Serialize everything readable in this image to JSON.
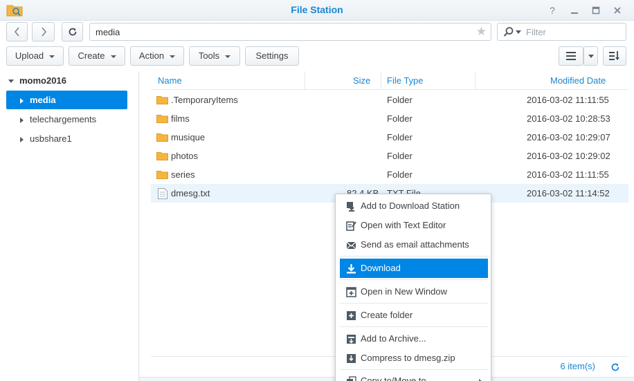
{
  "window": {
    "title": "File Station"
  },
  "toolbar": {
    "path": "media",
    "filter_placeholder": "Filter",
    "upload": "Upload",
    "create": "Create",
    "action": "Action",
    "tools": "Tools",
    "settings": "Settings"
  },
  "sidebar": {
    "root": "momo2016",
    "items": [
      {
        "label": "media",
        "selected": true
      },
      {
        "label": "telechargements",
        "selected": false
      },
      {
        "label": "usbshare1",
        "selected": false
      }
    ]
  },
  "table": {
    "columns": {
      "name": "Name",
      "size": "Size",
      "type": "File Type",
      "modified": "Modified Date"
    },
    "rows": [
      {
        "name": ".TemporaryItems",
        "size": "",
        "type": "Folder",
        "modified": "2016-03-02 11:11:55",
        "kind": "folder"
      },
      {
        "name": "films",
        "size": "",
        "type": "Folder",
        "modified": "2016-03-02 10:28:53",
        "kind": "folder"
      },
      {
        "name": "musique",
        "size": "",
        "type": "Folder",
        "modified": "2016-03-02 10:29:07",
        "kind": "folder"
      },
      {
        "name": "photos",
        "size": "",
        "type": "Folder",
        "modified": "2016-03-02 10:29:02",
        "kind": "folder"
      },
      {
        "name": "series",
        "size": "",
        "type": "Folder",
        "modified": "2016-03-02 11:11:55",
        "kind": "folder"
      },
      {
        "name": "dmesg.txt",
        "size": "82.4 KB",
        "type": "TXT File",
        "modified": "2016-03-02 11:14:52",
        "kind": "file"
      }
    ]
  },
  "status": {
    "count": "6 item(s)"
  },
  "context_menu": {
    "items": [
      {
        "label": "Add to Download Station",
        "icon": "download-station-icon"
      },
      {
        "label": "Open with Text Editor",
        "icon": "text-editor-icon"
      },
      {
        "label": "Send as email attachments",
        "icon": "email-icon"
      },
      {
        "label": "Download",
        "icon": "download-icon",
        "active": true
      },
      {
        "label": "Open in New Window",
        "icon": "new-window-icon"
      },
      {
        "label": "Create folder",
        "icon": "create-folder-icon"
      },
      {
        "label": "Add to Archive...",
        "icon": "archive-icon"
      },
      {
        "label": "Compress to dmesg.zip",
        "icon": "compress-icon"
      },
      {
        "label": "Copy to/Move to",
        "icon": "copy-move-icon"
      }
    ]
  },
  "colors": {
    "accent": "#0086e5",
    "link": "#1b86d3",
    "folder": "#f5b53f"
  }
}
